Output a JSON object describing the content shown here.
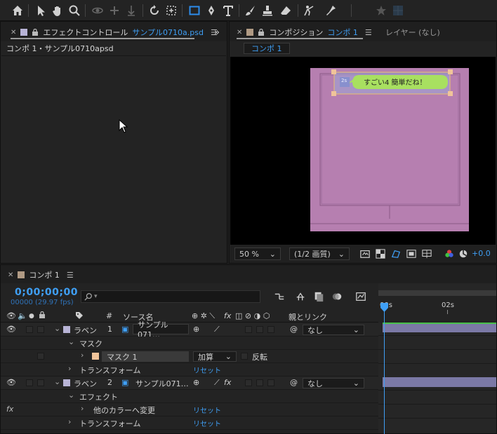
{
  "colors": {
    "accent": "#3f9ff5",
    "comp_bg": "#b67fb0",
    "layer_label": "#b8b4d6",
    "mask_swatch": "#f0c49a",
    "speech_bubble": "#a8e060"
  },
  "toolbar": {
    "tools": [
      "home-icon",
      "selection-icon",
      "hand-icon",
      "zoom-icon",
      "orbit-icon",
      "pan-behind-icon",
      "dolly-icon",
      "rotate-icon",
      "anchor-icon",
      "rectangle-icon",
      "pen-icon",
      "type-icon",
      "brush-icon",
      "clone-stamp-icon",
      "eraser-icon",
      "roto-brush-icon",
      "puppet-icon",
      "star-icon"
    ]
  },
  "effect_panel": {
    "tab_label": "エフェクトコントロール",
    "tab_file": "サンプル0710a.psd",
    "subtitle": "コンポ 1・サンプル0710apsd"
  },
  "comp_panel": {
    "tab_label": "コンポジション",
    "tab_name": "コンポ 1",
    "layer_tab": "レイヤー (なし)",
    "subtab": "コンポ 1",
    "bubble_text": "すごい4 簡単だね！",
    "bubble_small": "2s",
    "zoom": "50 %",
    "resolution": "(1/2 画質)",
    "exposure": "+0.0"
  },
  "timeline": {
    "tab_label": "コンポ 1",
    "timecode": "0;00;00;00",
    "fps": "00000 (29.97 fps)",
    "search_placeholder": "",
    "headers": {
      "num": "#",
      "source_name": "ソース名",
      "switches": "fx",
      "parent": "親とリンク"
    },
    "ruler": [
      "00s",
      "02s"
    ],
    "rows": [
      {
        "kind": "layer",
        "label": "ラベン",
        "num": "1",
        "name": "サンプル071…",
        "parent": "なし"
      },
      {
        "kind": "group",
        "label": "マスク"
      },
      {
        "kind": "mask",
        "label": "マスク 1",
        "mode": "加算",
        "invert": "反転"
      },
      {
        "kind": "prop",
        "label": "トランスフォーム",
        "value": "リセット"
      },
      {
        "kind": "layer",
        "label": "ラベン",
        "num": "2",
        "name": "サンプル071…",
        "parent": "なし"
      },
      {
        "kind": "group",
        "label": "エフェクト"
      },
      {
        "kind": "effect",
        "label": "他のカラーへ変更",
        "value": "リセット",
        "fx": "fx"
      },
      {
        "kind": "prop",
        "label": "トランスフォーム",
        "value": "リセット"
      }
    ]
  }
}
